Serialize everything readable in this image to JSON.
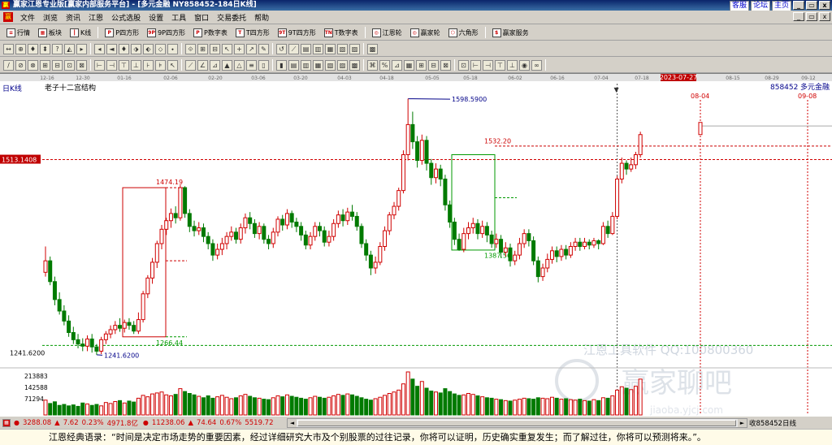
{
  "window": {
    "icon": "赢",
    "title": "赢家江恩专业版[赢家内部服务平台] - [多元金融  NY858452-184日K线]",
    "links": [
      "客服",
      "论坛",
      "主页"
    ],
    "controls": [
      "_",
      "▭",
      "x"
    ],
    "mdi_controls": [
      "_",
      "▭",
      "x"
    ]
  },
  "menu": {
    "items": [
      "文件",
      "浏览",
      "资讯",
      "江恩",
      "公式选股",
      "设置",
      "工具",
      "窗口",
      "交易委托",
      "帮助"
    ]
  },
  "toolbar1": {
    "items": [
      {
        "label": "行情",
        "icon": "list-icon"
      },
      {
        "label": "板块",
        "icon": "grid-icon"
      },
      {
        "label": "K线",
        "icon": "candle-icon"
      },
      {
        "label": "P四方形",
        "icon": "P"
      },
      {
        "label": "9P四方形",
        "icon": "9P"
      },
      {
        "label": "P数字表",
        "icon": "P"
      },
      {
        "label": "T四方形",
        "icon": "T"
      },
      {
        "label": "9T四方形",
        "icon": "9T"
      },
      {
        "label": "T数字表",
        "icon": "TN"
      },
      {
        "label": "江恩轮",
        "icon": "wheel-icon"
      },
      {
        "label": "赢家轮",
        "icon": "wheel-icon"
      },
      {
        "label": "六角形",
        "icon": "hexagon-icon"
      },
      {
        "label": "赢家服务",
        "icon": "dollar-icon"
      }
    ]
  },
  "toolbar2": {
    "glyphs": [
      "↔",
      "⊕",
      "♦",
      "⬍",
      "?",
      "◭",
      "▸",
      "◂",
      "◄",
      "♦",
      "⬗",
      "⬖",
      "⬦",
      "⬩",
      "⟐",
      "⊞",
      "⊟",
      "↖",
      "+",
      "↗",
      "✎",
      "↺",
      "⟋",
      "▤",
      "▥",
      "▦",
      "▧",
      "▨",
      "▩"
    ]
  },
  "toolbar3": {
    "glyphs": [
      "/",
      "⊘",
      "⊗",
      "⊞",
      "⊟",
      "⊡",
      "⊠",
      "⊢",
      "⊣",
      "⊤",
      "⊥",
      "⊦",
      "⊧",
      "↖",
      "⟋",
      "∠",
      "⊿",
      "▲",
      "△",
      "≡",
      "▯",
      "▮",
      "▤",
      "▥",
      "▦",
      "▧",
      "▨",
      "▩",
      "⌘",
      "%",
      "⊿",
      "▦",
      "⊞",
      "⊟",
      "⊠",
      "⊡",
      "⊢",
      "⊣",
      "⊤",
      "⊥",
      "◉",
      "∞"
    ]
  },
  "chart": {
    "period_label": "日K线",
    "structure_label": "老子十二宫结构",
    "code_label": "858452",
    "name_label": "多元金融",
    "current_price_label": "1513.1408",
    "bottom_level_label": "1241.6200",
    "highlight_date": "2023-07-27",
    "forecast_dates": [
      "08-04",
      "09-08"
    ],
    "watermark_text": "江恩工具软件  QQ:100800360",
    "watermark_logo": "赢家聊吧",
    "watermark_url": "jiaoba.yjcj.com",
    "volume_ticks": [
      "213883",
      "142588",
      "71294"
    ],
    "colors": {
      "up": "#d00000",
      "down": "#007a00",
      "box_red": "#cc0000",
      "box_green": "#009900",
      "hline_red": "#d00000",
      "hline_green": "#009900"
    }
  },
  "chart_data": {
    "type": "candlestick",
    "x_ticks": [
      "12-16",
      "12-30",
      "01-16",
      "02-06",
      "02-20",
      "03-06",
      "03-20",
      "04-03",
      "04-18",
      "05-05",
      "05-18",
      "06-02",
      "06-16",
      "07-04",
      "07-18",
      "2023-07-27",
      "08-15",
      "08-29",
      "09-12"
    ],
    "y_axis_labels": [
      "1513.1408",
      "1241.6200"
    ],
    "annotations": [
      {
        "text": "1474.19",
        "value": 1474.19
      },
      {
        "text": "1266.44",
        "value": 1266.44
      },
      {
        "text": "1241.6200",
        "value": 1241.62
      },
      {
        "text": "1598.5900",
        "value": 1598.59
      },
      {
        "text": "1532.20",
        "value": 1532.2
      },
      {
        "text": "1387.56",
        "value": 1387.56
      }
    ],
    "volume_axis": [
      "213883",
      "142588",
      "71294"
    ],
    "candles": [
      [
        1356,
        1372,
        1392,
        1350
      ],
      [
        1372,
        1343,
        1378,
        1338
      ],
      [
        1343,
        1318,
        1350,
        1310
      ],
      [
        1318,
        1302,
        1328,
        1297
      ],
      [
        1302,
        1288,
        1310,
        1282
      ],
      [
        1288,
        1272,
        1296,
        1266
      ],
      [
        1272,
        1262,
        1280,
        1256
      ],
      [
        1262,
        1256,
        1270,
        1250
      ],
      [
        1256,
        1253,
        1264,
        1246
      ],
      [
        1253,
        1263,
        1268,
        1246
      ],
      [
        1263,
        1252,
        1270,
        1244
      ],
      [
        1252,
        1246,
        1256,
        1241
      ],
      [
        1246,
        1262,
        1266,
        1242
      ],
      [
        1262,
        1270,
        1274,
        1256
      ],
      [
        1270,
        1276,
        1282,
        1264
      ],
      [
        1276,
        1282,
        1288,
        1270
      ],
      [
        1282,
        1278,
        1292,
        1273
      ],
      [
        1278,
        1286,
        1290,
        1272
      ],
      [
        1286,
        1282,
        1292,
        1276
      ],
      [
        1282,
        1274,
        1288,
        1270
      ],
      [
        1274,
        1290,
        1300,
        1270
      ],
      [
        1290,
        1326,
        1330,
        1286
      ],
      [
        1326,
        1348,
        1352,
        1320
      ],
      [
        1348,
        1370,
        1376,
        1340
      ],
      [
        1370,
        1396,
        1400,
        1362
      ],
      [
        1396,
        1416,
        1422,
        1388
      ],
      [
        1416,
        1428,
        1432,
        1408
      ],
      [
        1428,
        1438,
        1445,
        1418
      ],
      [
        1438,
        1432,
        1448,
        1424
      ],
      [
        1432,
        1474,
        1478,
        1428
      ],
      [
        1474,
        1438,
        1476,
        1432
      ],
      [
        1438,
        1420,
        1444,
        1412
      ],
      [
        1420,
        1414,
        1428,
        1406
      ],
      [
        1414,
        1418,
        1426,
        1408
      ],
      [
        1418,
        1406,
        1424,
        1398
      ],
      [
        1406,
        1396,
        1412,
        1388
      ],
      [
        1396,
        1380,
        1402,
        1372
      ],
      [
        1380,
        1388,
        1396,
        1374
      ],
      [
        1388,
        1396,
        1404,
        1380
      ],
      [
        1396,
        1406,
        1412,
        1388
      ],
      [
        1406,
        1412,
        1420,
        1400
      ],
      [
        1412,
        1402,
        1418,
        1396
      ],
      [
        1402,
        1418,
        1424,
        1396
      ],
      [
        1418,
        1432,
        1438,
        1410
      ],
      [
        1432,
        1424,
        1440,
        1416
      ],
      [
        1424,
        1410,
        1430,
        1404
      ],
      [
        1410,
        1420,
        1426,
        1402
      ],
      [
        1420,
        1402,
        1424,
        1396
      ],
      [
        1402,
        1396,
        1408,
        1388
      ],
      [
        1396,
        1412,
        1418,
        1390
      ],
      [
        1412,
        1430,
        1434,
        1406
      ],
      [
        1430,
        1422,
        1436,
        1414
      ],
      [
        1422,
        1438,
        1444,
        1416
      ],
      [
        1438,
        1426,
        1442,
        1418
      ],
      [
        1426,
        1420,
        1432,
        1412
      ],
      [
        1420,
        1408,
        1426,
        1400
      ],
      [
        1408,
        1394,
        1414,
        1388
      ],
      [
        1394,
        1406,
        1412,
        1388
      ],
      [
        1406,
        1420,
        1426,
        1400
      ],
      [
        1420,
        1414,
        1426,
        1406
      ],
      [
        1414,
        1398,
        1420,
        1392
      ],
      [
        1398,
        1406,
        1414,
        1392
      ],
      [
        1406,
        1424,
        1430,
        1400
      ],
      [
        1424,
        1436,
        1442,
        1418
      ],
      [
        1436,
        1428,
        1444,
        1420
      ],
      [
        1428,
        1440,
        1446,
        1422
      ],
      [
        1440,
        1434,
        1450,
        1428
      ],
      [
        1434,
        1420,
        1440,
        1414
      ],
      [
        1420,
        1396,
        1424,
        1390
      ],
      [
        1396,
        1380,
        1402,
        1372
      ],
      [
        1380,
        1362,
        1386,
        1352
      ],
      [
        1362,
        1370,
        1378,
        1354
      ],
      [
        1370,
        1392,
        1398,
        1366
      ],
      [
        1392,
        1414,
        1420,
        1386
      ],
      [
        1414,
        1436,
        1440,
        1408
      ],
      [
        1436,
        1448,
        1454,
        1430
      ],
      [
        1448,
        1470,
        1474,
        1442
      ],
      [
        1470,
        1520,
        1526,
        1466
      ],
      [
        1520,
        1562,
        1598,
        1512
      ],
      [
        1562,
        1538,
        1580,
        1528
      ],
      [
        1538,
        1512,
        1546,
        1502
      ],
      [
        1512,
        1540,
        1548,
        1506
      ],
      [
        1540,
        1508,
        1546,
        1498
      ],
      [
        1508,
        1488,
        1514,
        1478
      ],
      [
        1488,
        1500,
        1508,
        1480
      ],
      [
        1500,
        1486,
        1506,
        1476
      ],
      [
        1486,
        1450,
        1492,
        1442
      ],
      [
        1450,
        1426,
        1456,
        1418
      ],
      [
        1426,
        1402,
        1432,
        1394
      ],
      [
        1402,
        1388,
        1410,
        1386
      ],
      [
        1388,
        1410,
        1418,
        1384
      ],
      [
        1410,
        1418,
        1426,
        1402
      ],
      [
        1418,
        1424,
        1432,
        1410
      ],
      [
        1424,
        1410,
        1430,
        1402
      ],
      [
        1410,
        1420,
        1428,
        1404
      ],
      [
        1420,
        1408,
        1426,
        1398
      ],
      [
        1408,
        1396,
        1414,
        1390
      ],
      [
        1396,
        1402,
        1410,
        1390
      ],
      [
        1402,
        1384,
        1408,
        1376
      ],
      [
        1384,
        1390,
        1398,
        1378
      ],
      [
        1390,
        1372,
        1396,
        1364
      ],
      [
        1372,
        1380,
        1386,
        1366
      ],
      [
        1380,
        1396,
        1404,
        1374
      ],
      [
        1396,
        1410,
        1416,
        1390
      ],
      [
        1410,
        1400,
        1416,
        1392
      ],
      [
        1400,
        1372,
        1406,
        1366
      ],
      [
        1372,
        1350,
        1378,
        1342
      ],
      [
        1350,
        1362,
        1368,
        1344
      ],
      [
        1362,
        1374,
        1382,
        1356
      ],
      [
        1374,
        1386,
        1392,
        1368
      ],
      [
        1386,
        1378,
        1392,
        1370
      ],
      [
        1378,
        1388,
        1394,
        1372
      ],
      [
        1388,
        1380,
        1394,
        1374
      ],
      [
        1380,
        1392,
        1398,
        1376
      ],
      [
        1392,
        1398,
        1404,
        1386
      ],
      [
        1398,
        1392,
        1404,
        1386
      ],
      [
        1392,
        1398,
        1404,
        1388
      ],
      [
        1398,
        1394,
        1402,
        1388
      ],
      [
        1394,
        1400,
        1404,
        1390
      ],
      [
        1400,
        1396,
        1402,
        1388
      ],
      [
        1396,
        1420,
        1426,
        1394
      ],
      [
        1420,
        1410,
        1428,
        1404
      ],
      [
        1410,
        1434,
        1440,
        1408
      ],
      [
        1434,
        1486,
        1490,
        1430
      ],
      [
        1486,
        1508,
        1516,
        1480
      ],
      [
        1508,
        1500,
        1512,
        1492
      ],
      [
        1500,
        1506,
        1516,
        1496
      ],
      [
        1506,
        1520,
        1524,
        1500
      ],
      [
        1520,
        1548,
        1552,
        1516
      ]
    ],
    "volumes": [
      62,
      48,
      55,
      40,
      44,
      38,
      42,
      36,
      50,
      46,
      40,
      44,
      38,
      52,
      48,
      56,
      60,
      50,
      58,
      54,
      70,
      82,
      76,
      88,
      92,
      96,
      84,
      80,
      86,
      110,
      98,
      90,
      84,
      78,
      72,
      80,
      70,
      76,
      82,
      74,
      68,
      72,
      80,
      86,
      78,
      72,
      70,
      66,
      64,
      72,
      80,
      76,
      84,
      78,
      74,
      70,
      66,
      72,
      78,
      74,
      70,
      74,
      80,
      86,
      82,
      88,
      84,
      78,
      72,
      66,
      62,
      68,
      74,
      82,
      90,
      96,
      104,
      130,
      180,
      150,
      120,
      140,
      112,
      100,
      96,
      92,
      110,
      98,
      88,
      82,
      84,
      90,
      86,
      80,
      76,
      72,
      70,
      66,
      64,
      60,
      58,
      62,
      66,
      70,
      68,
      66,
      72,
      70,
      68,
      74,
      70,
      66,
      68,
      64,
      62,
      66,
      60,
      58,
      64,
      60,
      72,
      70,
      80,
      104,
      118,
      112,
      106,
      120,
      150
    ]
  },
  "status": {
    "index1": {
      "value": "3288.08",
      "change": "7.62",
      "pct": "0.23%",
      "amount": "4971.8亿"
    },
    "index2": {
      "value": "11238.06",
      "change": "74.64",
      "pct": "0.67%",
      "amount": "5519.72"
    },
    "right_text": "收858452日线"
  },
  "quote": {
    "text": "江恩经典语录：“时间是决定市场走势的重要因素，经过详细研究大市及个别股票的过往记录，你将可以证明，历史确实重复发生；而了解过往，你将可以预测将来。”。"
  }
}
